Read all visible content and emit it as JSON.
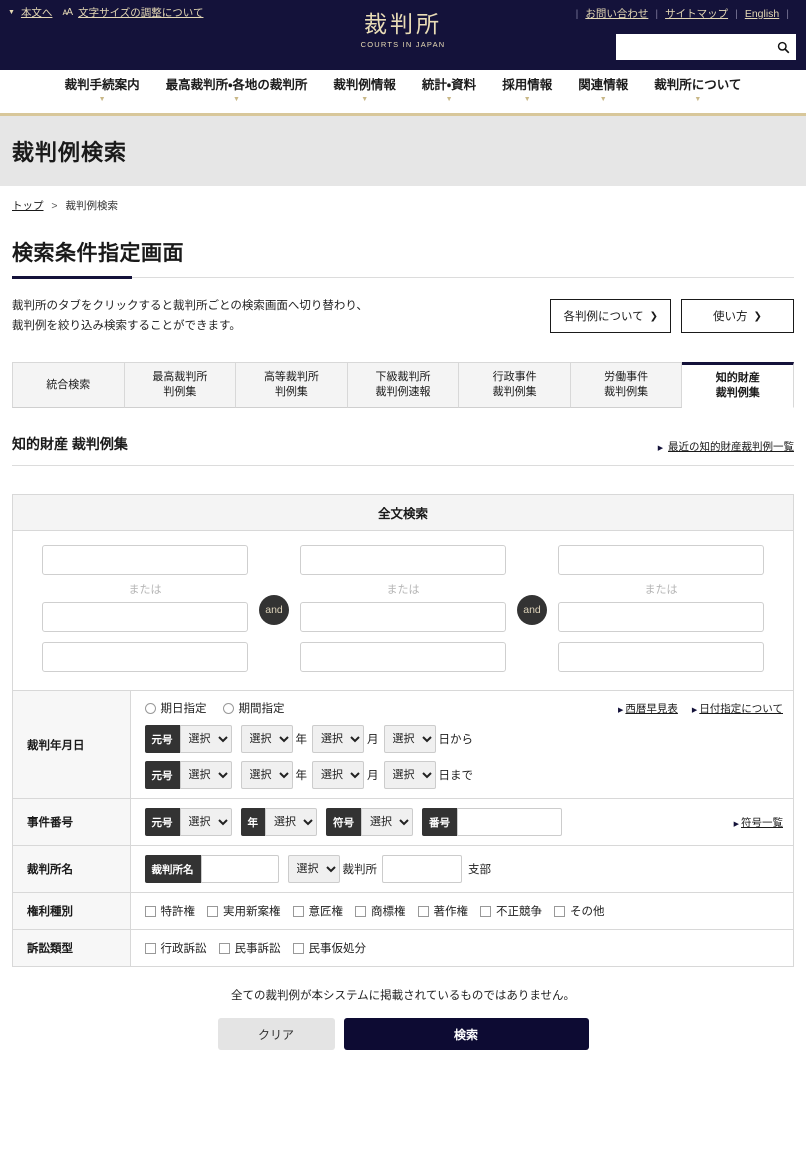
{
  "header": {
    "skip_link": "本文へ",
    "font_size_link": "文字サイズの調整について",
    "logo_jp": "裁判所",
    "logo_en": "COURTS IN JAPAN",
    "util_links": [
      "お問い合わせ",
      "サイトマップ",
      "English"
    ],
    "search_placeholder": "",
    "search_value": "",
    "search_icon": "search-icon"
  },
  "gnav": [
    {
      "label": "裁判手続案内"
    },
    {
      "label": "最高裁判所・各地の裁判所"
    },
    {
      "label": "裁判例情報"
    },
    {
      "label": "統計・資料"
    },
    {
      "label": "採用情報"
    },
    {
      "label": "関連情報"
    },
    {
      "label": "裁判所について"
    }
  ],
  "page": {
    "band_title": "裁判例検索",
    "breadcrumb_home": "トップ",
    "breadcrumb_sep": ">",
    "breadcrumb_current": "裁判例検索",
    "heading": "検索条件指定画面",
    "intro_line1": "裁判所のタブをクリックすると裁判所ごとの検索画面へ切り替わり、",
    "intro_line2": "裁判例を絞り込み検索することができます。",
    "btn_about_cases": "各判例について",
    "btn_howto": "使い方",
    "arrow_glyph": "❯"
  },
  "tabs": [
    {
      "line1": "統合検索",
      "line2": "",
      "active": false
    },
    {
      "line1": "最高裁判所",
      "line2": "判例集",
      "active": false
    },
    {
      "line1": "高等裁判所",
      "line2": "判例集",
      "active": false
    },
    {
      "line1": "下級裁判所",
      "line2": "裁判例速報",
      "active": false
    },
    {
      "line1": "行政事件",
      "line2": "裁判例集",
      "active": false
    },
    {
      "line1": "労働事件",
      "line2": "裁判例集",
      "active": false
    },
    {
      "line1": "知的財産",
      "line2": "裁判例集",
      "active": true
    }
  ],
  "section": {
    "title": "知的財産 裁判例集",
    "recent_link": "最近の知的財産裁判例一覧"
  },
  "fulltext": {
    "panel_title": "全文検索",
    "or_label": "または",
    "and_label": "and",
    "groups": [
      {
        "values": [
          "",
          "",
          ""
        ]
      },
      {
        "values": [
          "",
          "",
          ""
        ]
      },
      {
        "values": [
          "",
          "",
          ""
        ]
      }
    ]
  },
  "form": {
    "date": {
      "label": "裁判年月日",
      "radio_single": "期日指定",
      "radio_range": "期間指定",
      "link_calendar": "西暦早見表",
      "link_about": "日付指定について",
      "era_tag": "元号",
      "select_placeholder": "選択",
      "unit_year": "年",
      "unit_month": "月",
      "from_suffix": "日から",
      "to_suffix": "日まで",
      "from": {
        "era": "選択",
        "year": "選択",
        "month": "選択",
        "day": "選択"
      },
      "to": {
        "era": "選択",
        "year": "選択",
        "month": "選択",
        "day": "選択"
      }
    },
    "case_no": {
      "label": "事件番号",
      "era_tag": "元号",
      "era_value": "選択",
      "year_tag": "年",
      "year_value": "選択",
      "mark_tag": "符号",
      "mark_value": "選択",
      "number_tag": "番号",
      "number_value": "",
      "link_marks": "符号一覧"
    },
    "court": {
      "label": "裁判所名",
      "name_tag": "裁判所名",
      "name_value": "",
      "select_value": "選択",
      "court_suffix": "裁判所",
      "branch_value": "",
      "branch_suffix": "支部"
    },
    "right_type": {
      "label": "権利種別",
      "options": [
        "特許権",
        "実用新案権",
        "意匠権",
        "商標権",
        "著作権",
        "不正競争",
        "その他"
      ]
    },
    "suit_type": {
      "label": "訴訟類型",
      "options": [
        "行政訴訟",
        "民事訴訟",
        "民事仮処分"
      ]
    }
  },
  "footer": {
    "note": "全ての裁判例が本システムに掲載されているものではありません。",
    "btn_clear": "クリア",
    "btn_search": "検索"
  }
}
